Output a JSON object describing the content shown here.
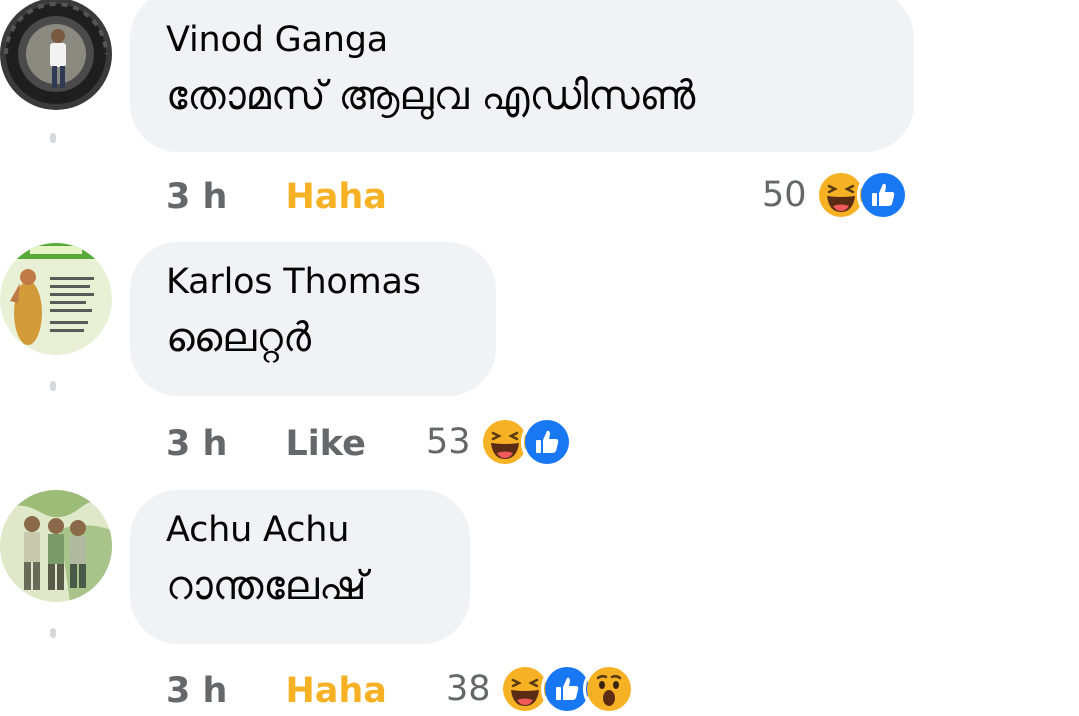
{
  "comments": [
    {
      "author": "Vinod Ganga",
      "text": "തോമസ് ആലുവ എഡിസൺ",
      "time": "3 h",
      "action": "Haha",
      "reaction_count": "50",
      "reactions": [
        "haha-emoji",
        "like-emoji"
      ]
    },
    {
      "author": "Karlos Thomas",
      "text": "ലൈറ്റർ",
      "time": "3 h",
      "action": "Like",
      "reaction_count": "53",
      "reactions": [
        "haha-emoji",
        "like-emoji"
      ]
    },
    {
      "author": "Achu Achu",
      "text": "റാന്തലേഷ്",
      "time": "3 h",
      "action": "Haha",
      "reaction_count": "38",
      "reactions": [
        "haha-emoji",
        "like-emoji",
        "wow-emoji"
      ]
    }
  ],
  "colors": {
    "bubble": "#f0f2f5",
    "haha_action": "#f7b125",
    "like_blue": "#1877f2",
    "meta_gray": "#65676b"
  }
}
